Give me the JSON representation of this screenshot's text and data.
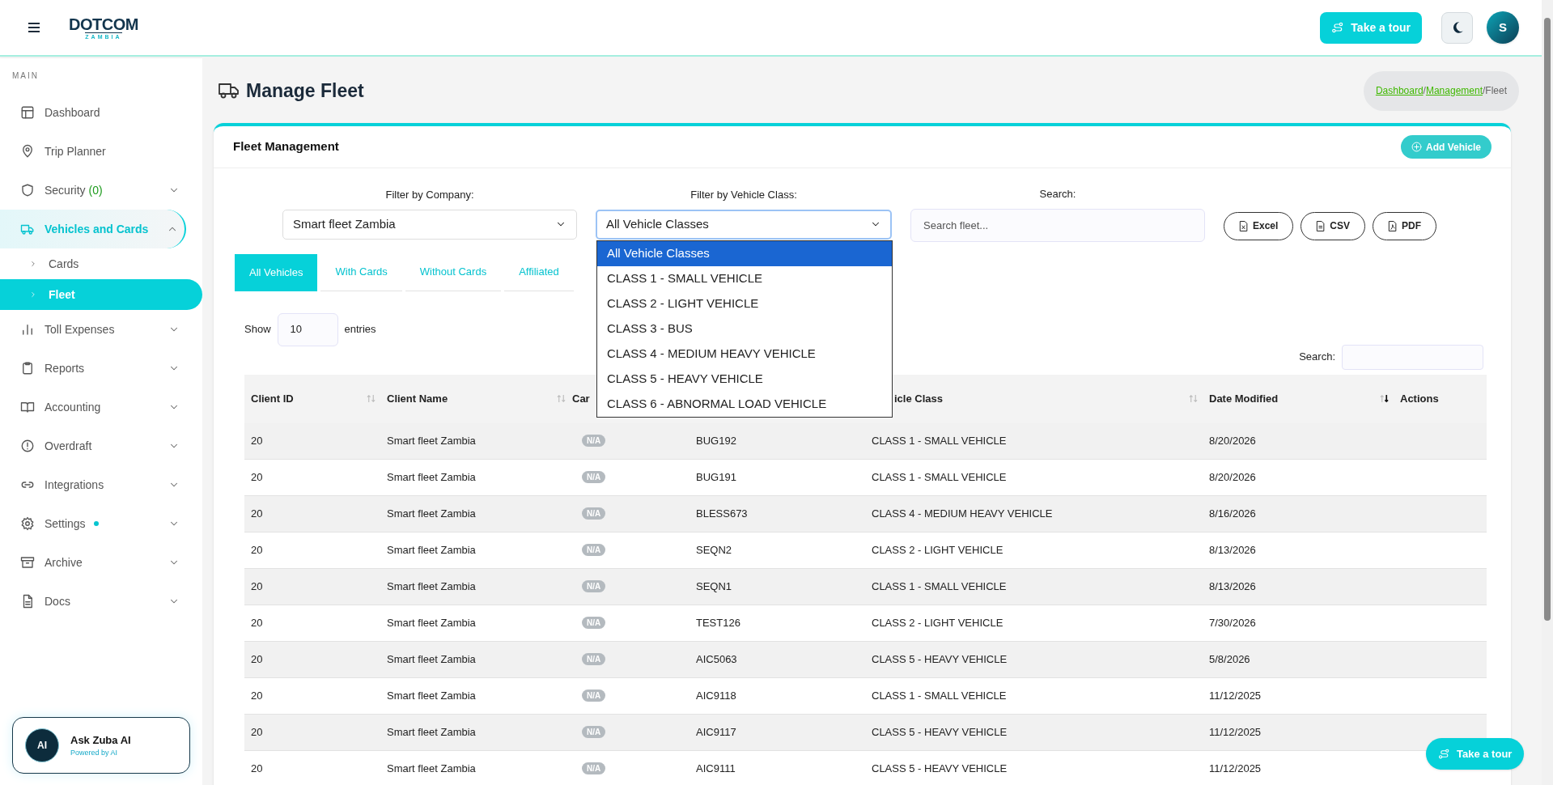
{
  "header": {
    "logo": {
      "name": "DOTCOM",
      "sub": "ZAMBIA"
    },
    "tour_button": "Take a tour",
    "avatar": "S"
  },
  "sidebar": {
    "section": "MAIN",
    "items": [
      {
        "label": "Dashboard",
        "kind": "link",
        "selected": false
      },
      {
        "label": "Trip Planner",
        "kind": "link",
        "selected": false
      },
      {
        "label": "Security",
        "count": "(0)",
        "kind": "group",
        "expanded": false,
        "selected": false
      },
      {
        "label": "Vehicles and Cards",
        "kind": "group",
        "expanded": true,
        "selected": true,
        "children": [
          {
            "label": "Cards",
            "selected": false
          },
          {
            "label": "Fleet",
            "selected": true
          }
        ]
      },
      {
        "label": "Toll Expenses",
        "kind": "group",
        "expanded": false,
        "selected": false
      },
      {
        "label": "Reports",
        "kind": "group",
        "expanded": false,
        "selected": false
      },
      {
        "label": "Accounting",
        "kind": "group",
        "expanded": false,
        "selected": false
      },
      {
        "label": "Overdraft",
        "kind": "group",
        "expanded": false,
        "selected": false
      },
      {
        "label": "Integrations",
        "kind": "group",
        "expanded": false,
        "selected": false
      },
      {
        "label": "Settings",
        "kind": "group",
        "expanded": false,
        "selected": false,
        "notification": true
      },
      {
        "label": "Archive",
        "kind": "group",
        "expanded": false,
        "selected": false
      },
      {
        "label": "Docs",
        "kind": "group",
        "expanded": false,
        "selected": false
      }
    ],
    "assistant": {
      "title": "Ask Zuba AI",
      "subtitle": "Powered by AI",
      "badge": "AI"
    }
  },
  "page": {
    "title": "Manage Fleet",
    "breadcrumb": [
      {
        "label": "Dashboard",
        "link": true
      },
      {
        "label": "/",
        "link": false
      },
      {
        "label": "Management",
        "link": true
      },
      {
        "label": "/Fleet",
        "link": false
      }
    ]
  },
  "card": {
    "title": "Fleet Management",
    "add_button": "Add Vehicle",
    "filters": {
      "company_label": "Filter by Company:",
      "company_value": "Smart fleet Zambia",
      "class_label": "Filter by Vehicle Class:",
      "class_value": "All Vehicle Classes",
      "search_label": "Search:",
      "search_placeholder": "Search fleet..."
    },
    "class_options": [
      {
        "label": "All Vehicle Classes",
        "selected": true
      },
      {
        "label": "CLASS 1 - SMALL VEHICLE",
        "selected": false
      },
      {
        "label": "CLASS 2 - LIGHT VEHICLE",
        "selected": false
      },
      {
        "label": "CLASS 3 - BUS",
        "selected": false
      },
      {
        "label": "CLASS 4 - MEDIUM HEAVY VEHICLE",
        "selected": false
      },
      {
        "label": "CLASS 5 - HEAVY VEHICLE",
        "selected": false
      },
      {
        "label": "CLASS 6 - ABNORMAL LOAD VEHICLE",
        "selected": false
      }
    ],
    "exports": [
      "Excel",
      "CSV",
      "PDF"
    ],
    "tabs": [
      {
        "label": "All Vehicles",
        "selected": true
      },
      {
        "label": "With Cards",
        "selected": false
      },
      {
        "label": "Without Cards",
        "selected": false
      },
      {
        "label": "Affiliated",
        "selected": false
      }
    ],
    "length": {
      "before": "Show",
      "value": "10",
      "after": "entries"
    },
    "table_search_label": "Search:",
    "table": {
      "columns": [
        {
          "label": "Client ID",
          "sortable": true,
          "sorted": false
        },
        {
          "label": "Client Name",
          "sortable": true,
          "sorted": false
        },
        {
          "label": "Car"
        },
        {},
        {
          "label": "icle Class",
          "sortable": true,
          "sorted": false
        },
        {
          "label": "Date Modified",
          "sortable": true,
          "sorted": true
        },
        {
          "label": "Actions"
        }
      ],
      "rows": [
        [
          "20",
          "Smart fleet Zambia",
          "N/A",
          "BUG192",
          "CLASS 1 - SMALL VEHICLE",
          "8/20/2026"
        ],
        [
          "20",
          "Smart fleet Zambia",
          "N/A",
          "BUG191",
          "CLASS 1 - SMALL VEHICLE",
          "8/20/2026"
        ],
        [
          "20",
          "Smart fleet Zambia",
          "N/A",
          "BLESS673",
          "CLASS 4 - MEDIUM HEAVY VEHICLE",
          "8/16/2026"
        ],
        [
          "20",
          "Smart fleet Zambia",
          "N/A",
          "SEQN2",
          "CLASS 2 - LIGHT VEHICLE",
          "8/13/2026"
        ],
        [
          "20",
          "Smart fleet Zambia",
          "N/A",
          "SEQN1",
          "CLASS 1 - SMALL VEHICLE",
          "8/13/2026"
        ],
        [
          "20",
          "Smart fleet Zambia",
          "N/A",
          "TEST126",
          "CLASS 2 - LIGHT VEHICLE",
          "7/30/2026"
        ],
        [
          "20",
          "Smart fleet Zambia",
          "N/A",
          "AIC5063",
          "CLASS 5 - HEAVY VEHICLE",
          "5/8/2026"
        ],
        [
          "20",
          "Smart fleet Zambia",
          "N/A",
          "AIC9118",
          "CLASS 1 - SMALL VEHICLE",
          "11/12/2025"
        ],
        [
          "20",
          "Smart fleet Zambia",
          "N/A",
          "AIC9117",
          "CLASS 5 - HEAVY VEHICLE",
          "11/12/2025"
        ],
        [
          "20",
          "Smart fleet Zambia",
          "N/A",
          "AIC9111",
          "CLASS 5 - HEAVY VEHICLE",
          "11/12/2025"
        ]
      ]
    }
  },
  "floating_tour_button": "Take a tour"
}
